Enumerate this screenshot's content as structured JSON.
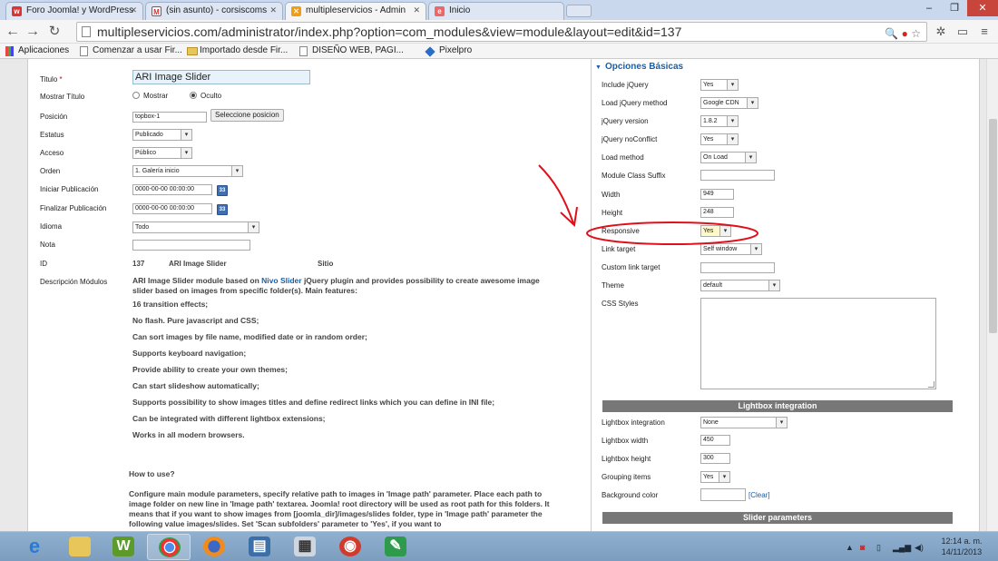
{
  "browser": {
    "tabs": [
      {
        "label": "Foro Joomla! y WordPress",
        "icon": "joomla-forum-icon"
      },
      {
        "label": "(sin asunto) - corsiscoms",
        "icon": "gmail-icon"
      },
      {
        "label": "multipleservicios - Admin",
        "icon": "joomla-icon"
      },
      {
        "label": "Inicio",
        "icon": "site-icon"
      }
    ],
    "url": "multipleservicios.com/administrator/index.php?option=com_modules&view=module&layout=edit&id=137",
    "bookmarks": [
      {
        "label": "Aplicaciones"
      },
      {
        "label": "Comenzar a usar Fir..."
      },
      {
        "label": "Importado desde Fir..."
      },
      {
        "label": "DISEÑO WEB, PAGI..."
      },
      {
        "label": "Pixelpro"
      }
    ]
  },
  "left": {
    "titulo_label": "Titulo",
    "titulo_req": "*",
    "titulo_value": "ARI Image Slider",
    "mostrar_titulo_label": "Mostrar Título",
    "mostrar_option": "Mostrar",
    "oculto_option": "Oculto",
    "posicion_label": "Posición",
    "posicion_value": "topbox-1",
    "posicion_button": "Seleccione posicion",
    "estatus_label": "Estatus",
    "estatus_value": "Publicado",
    "acceso_label": "Acceso",
    "acceso_value": "Público",
    "orden_label": "Orden",
    "orden_value": "1. Galería inicio",
    "iniciar_label": "Iniciar Publicación",
    "iniciar_value": "0000-00-00 00:00:00",
    "finalizar_label": "Finalizar Publicación",
    "finalizar_value": "0000-00-00 00:00:00",
    "idioma_label": "Idioma",
    "idioma_value": "Todo",
    "nota_label": "Nota",
    "id_label": "ID",
    "id_value": "137",
    "id_name": "ARI Image Slider",
    "id_site": "Sitio",
    "descripcion_label": "Descripción Módulos",
    "desc_line1_a": "ARI Image Slider module based on ",
    "desc_line1_link": "Nivo Slider",
    "desc_line1_b": " jQuery plugin and provides possibility to create awesome image slider based on images from specific folder(s). Main features:",
    "features": [
      "16 transition effects;",
      "No flash. Pure javascript and CSS;",
      "Can sort images by file name, modified date or in random order;",
      "Supports keyboard navigation;",
      "Provide ability to create your own themes;",
      "Can start slideshow automatically;",
      "Supports possibility to show images titles and define redirect links which you can define in INI file;",
      "Can be integrated with different lightbox extensions;",
      "Works in all modern browsers."
    ],
    "howto_title": "How to use?",
    "howto_body": "Configure main module parameters, specify relative path to images in 'Image path' parameter. Place each path to image folder on new line in 'Image path' textarea. Joomla! root directory will be used as root path for this folders. It means that if you want to show images from [joomla_dir]/images/slides folder, type in 'Image path' parameter the following value images/slides. Set 'Scan subfolders' parameter to 'Yes', if you want to"
  },
  "right": {
    "header": "Opciones Básicas",
    "fields": {
      "include_jquery": {
        "label": "Include jQuery",
        "value": "Yes"
      },
      "load_method_jq": {
        "label": "Load jQuery method",
        "value": "Google CDN"
      },
      "jquery_version": {
        "label": "jQuery version",
        "value": "1.8.2"
      },
      "noconflict": {
        "label": "jQuery noConflict",
        "value": "Yes"
      },
      "load_method": {
        "label": "Load method",
        "value": "On Load"
      },
      "class_suffix": {
        "label": "Module Class Suffix",
        "value": ""
      },
      "width": {
        "label": "Width",
        "value": "949"
      },
      "height": {
        "label": "Height",
        "value": "248"
      },
      "responsive": {
        "label": "Responsive",
        "value": "Yes"
      },
      "link_target": {
        "label": "Link target",
        "value": "Self window"
      },
      "custom_link_target": {
        "label": "Custom link target",
        "value": ""
      },
      "theme": {
        "label": "Theme",
        "value": "default"
      },
      "css_styles": {
        "label": "CSS Styles"
      }
    },
    "lightbox_bar": "Lightbox integration",
    "lightbox": {
      "integration": {
        "label": "Lightbox integration",
        "value": "None"
      },
      "width": {
        "label": "Lightbox width",
        "value": "450"
      },
      "height": {
        "label": "Lightbox height",
        "value": "300"
      },
      "grouping": {
        "label": "Grouping items",
        "value": "Yes"
      },
      "bgcolor": {
        "label": "Background color",
        "value": "",
        "clear": "[Clear]"
      }
    },
    "slider_bar": "Slider parameters"
  },
  "taskbar": {
    "clock_time": "12:14 a. m.",
    "clock_date": "14/11/2013"
  },
  "colors": {
    "link": "#1a5fa8",
    "annotation": "#e0101a",
    "section_bar": "#777777"
  }
}
